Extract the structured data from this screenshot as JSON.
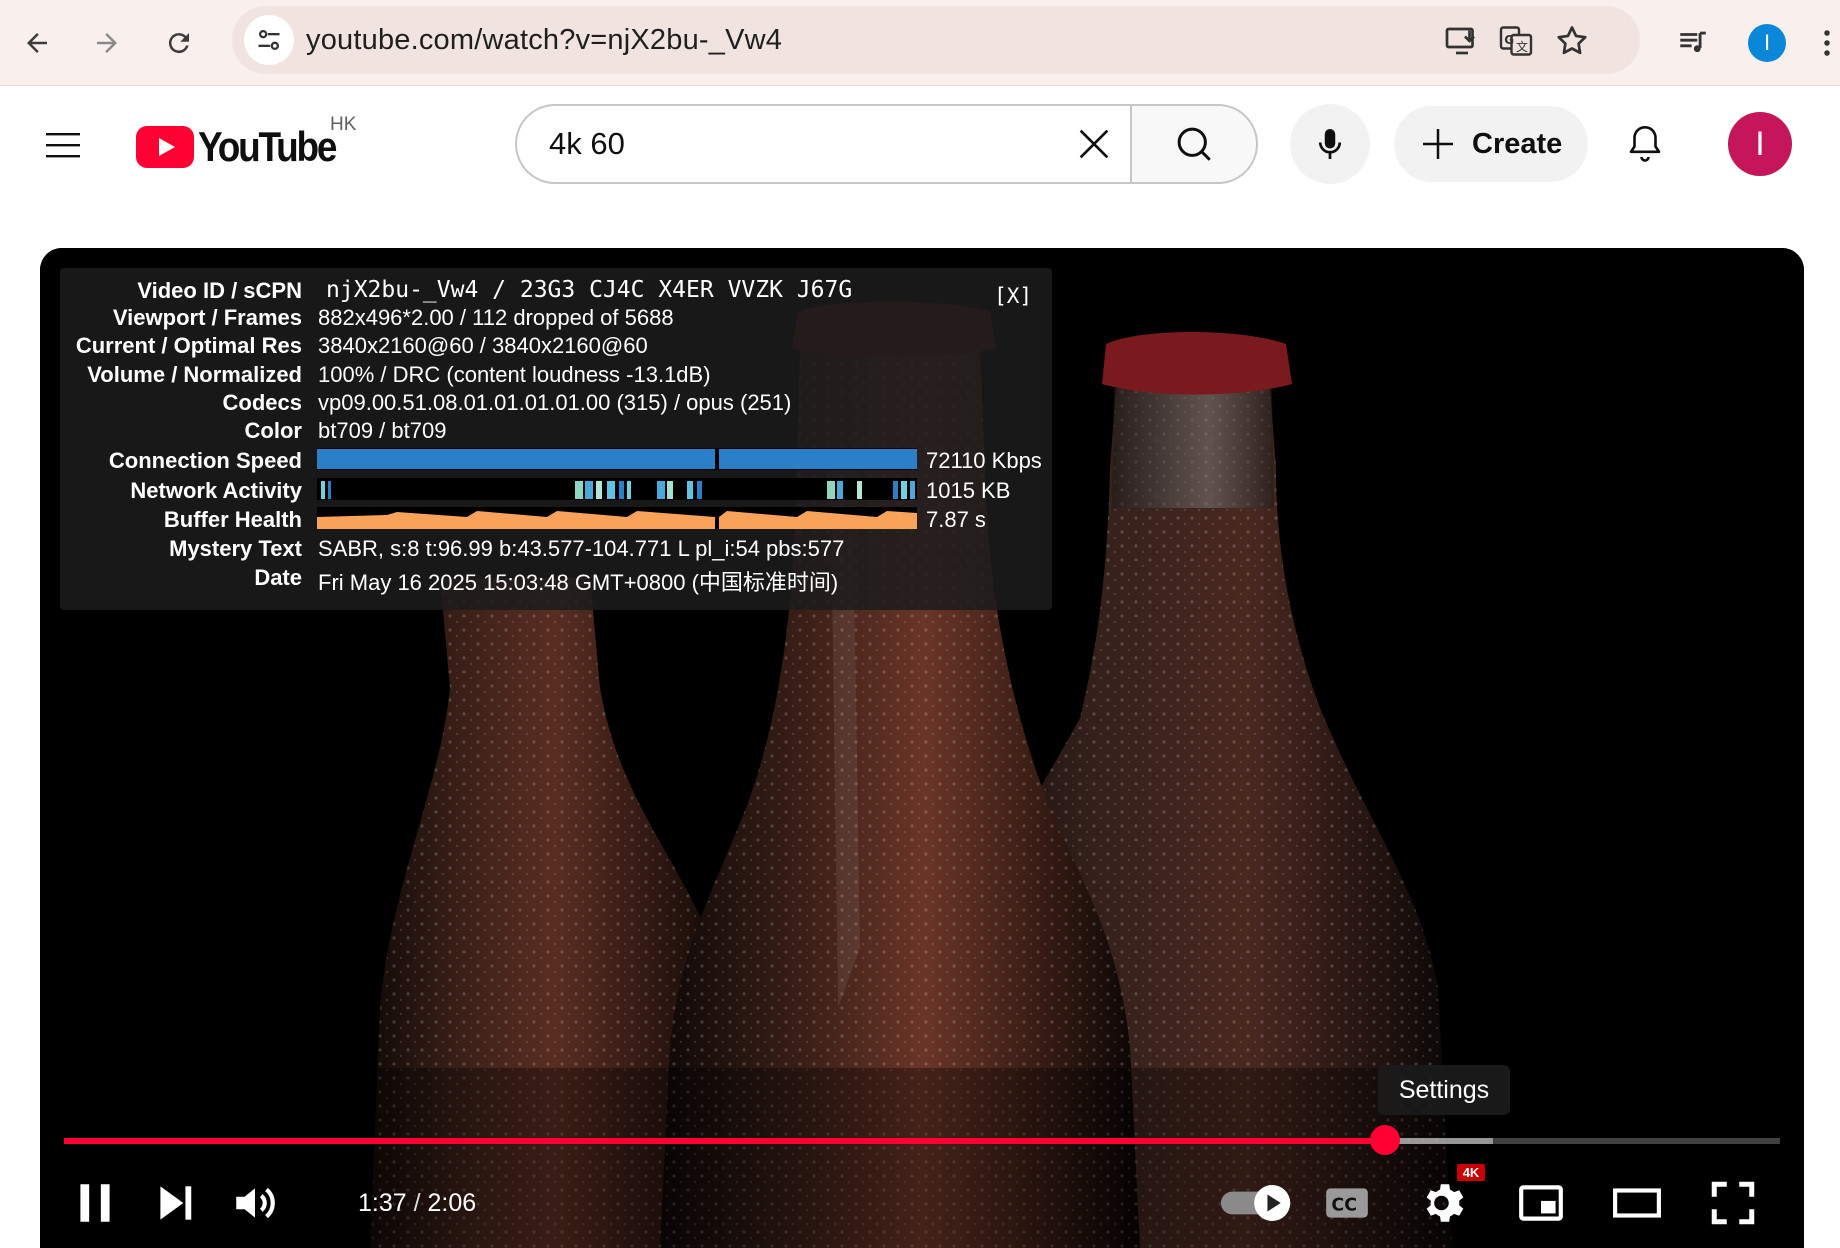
{
  "browser": {
    "url": "youtube.com/watch?v=njX2bu-_Vw4",
    "profile_initial": "I"
  },
  "header": {
    "logo_text": "YouTube",
    "region": "HK",
    "search_value": "4k 60",
    "search_placeholder": "Search",
    "create_label": "Create",
    "avatar_initial": "I"
  },
  "stats_panel": {
    "close_label": "[X]",
    "rows": [
      {
        "label": "Video ID / sCPN",
        "value": "njX2bu-_Vw4 / 23G3 CJ4C X4ER VVZK J67G"
      },
      {
        "label": "Viewport / Frames",
        "value": "882x496*2.00 / 112 dropped of 5688"
      },
      {
        "label": "Current / Optimal Res",
        "value": "3840x2160@60 / 3840x2160@60"
      },
      {
        "label": "Volume / Normalized",
        "value": "100% / DRC (content loudness -13.1dB)"
      },
      {
        "label": "Codecs",
        "value": "vp09.00.51.08.01.01.01.01.00 (315) / opus (251)"
      },
      {
        "label": "Color",
        "value": "bt709 / bt709"
      },
      {
        "label": "Connection Speed",
        "value": "72110 Kbps"
      },
      {
        "label": "Network Activity",
        "value": "1015 KB"
      },
      {
        "label": "Buffer Health",
        "value": "7.87 s"
      },
      {
        "label": "Mystery Text",
        "value": "SABR, s:8 t:96.99 b:43.577-104.771 L pl_i:54 pbs:577"
      },
      {
        "label": "Date",
        "value": "Fri May 16 2025 15:03:48 GMT+0800 (中国标准时间)"
      }
    ]
  },
  "player": {
    "tooltip": "Settings",
    "current_time": "1:37",
    "duration": "2:06",
    "progress_fraction": 0.77,
    "buffered_fraction": 0.833,
    "quality_badge": "4K",
    "colors": {
      "progress": "#ff0033",
      "connection_bar": "#2b7fc8",
      "buffer_bar": "#f9a35a"
    }
  }
}
